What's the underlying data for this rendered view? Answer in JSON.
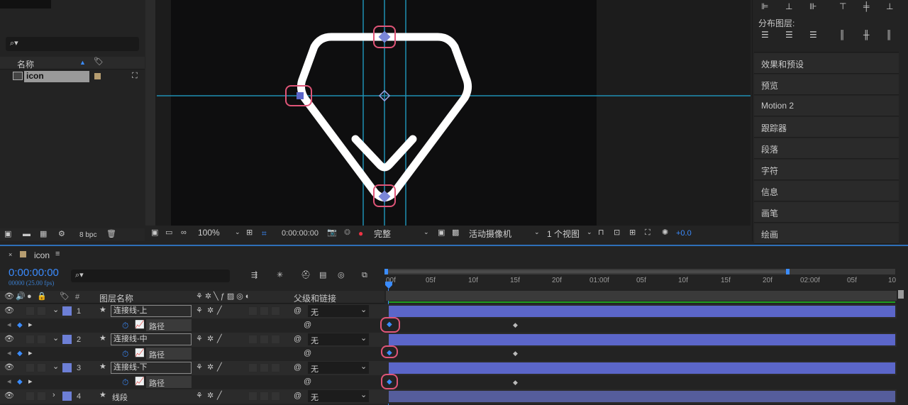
{
  "project": {
    "search_placeholder": "",
    "col_name": "名称",
    "item_name": "icon",
    "bpc": "8 bpc"
  },
  "viewer": {
    "zoom": "100%",
    "timecode": "0:00:00:00",
    "quality": "完整",
    "camera": "活动摄像机",
    "views": "1 个视图",
    "exposure": "+0.0"
  },
  "right_panel": {
    "distribute_label": "分布图层:",
    "items": [
      "效果和预设",
      "预览",
      "Motion 2",
      "跟踪器",
      "段落",
      "字符",
      "信息",
      "画笔",
      "绘画"
    ]
  },
  "timeline": {
    "comp_tab": "icon",
    "current_time": "0:00:00:00",
    "fps_info": "00000 (25.00 fps)",
    "col_hash": "#",
    "col_layer_name": "图层名称",
    "col_parent": "父级和链接",
    "ruler_ticks": [
      "00f",
      "05f",
      "10f",
      "15f",
      "20f",
      "01:00f",
      "05f",
      "10f",
      "15f",
      "20f",
      "02:00f",
      "05f",
      "10"
    ],
    "layers": [
      {
        "num": "1",
        "name": "连接线-上",
        "parent": "无",
        "prop": "路径"
      },
      {
        "num": "2",
        "name": "连接线-中",
        "parent": "无",
        "prop": "路径"
      },
      {
        "num": "3",
        "name": "连接线-下",
        "parent": "无",
        "prop": "路径"
      },
      {
        "num": "4",
        "name": "线段",
        "parent": "无"
      }
    ]
  },
  "colors": {
    "accent": "#3b8cff",
    "layer_label": "#6d7fd6",
    "bar": "#5b66c9",
    "highlight_ring": "#e05578",
    "guide": "#1f8fb4"
  }
}
